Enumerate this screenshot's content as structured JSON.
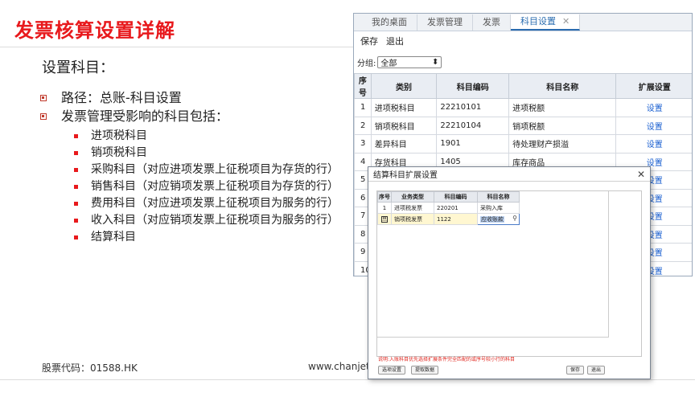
{
  "slide": {
    "title": "发票核算设置详解",
    "subtitle": "设置科目：",
    "bullets": [
      "路径：总账-科目设置",
      "发票管理受影响的科目包括："
    ],
    "sub_bullets": [
      "进项税科目",
      "销项税科目",
      "采购科目（对应进项发票上征税项目为存货的行）",
      "销售科目（对应销项发票上征税项目为存货的行）",
      "费用科目（对应进项发票上征税项目为服务的行）",
      "收入科目（对应销项发票上征税项目为服务的行）",
      "结算科目"
    ],
    "footer_code": "股票代码：01588.HK",
    "footer_url": "www.chanjet"
  },
  "app": {
    "tabs": [
      "我的桌面",
      "发票管理",
      "发票",
      "科目设置"
    ],
    "close_glyph": "✕",
    "toolbar": {
      "save": "保存",
      "exit": "退出"
    },
    "filter": {
      "label": "分组:",
      "value": "全部",
      "arrow": "⬍"
    },
    "grid": {
      "headers": [
        "序号",
        "类别",
        "科目编码",
        "科目名称",
        "扩展设置"
      ],
      "rows": [
        [
          "1",
          "进项税科目",
          "22210101",
          "进项税额",
          "设置"
        ],
        [
          "2",
          "销项税科目",
          "22210104",
          "销项税额",
          "设置"
        ],
        [
          "3",
          "差异科目",
          "1901",
          "待处理财产损溢",
          "设置"
        ],
        [
          "4",
          "存货科目",
          "1405",
          "库存商品",
          "设置"
        ],
        [
          "5",
          "",
          "",
          "",
          "设置"
        ],
        [
          "6",
          "",
          "",
          "",
          "设置"
        ],
        [
          "7",
          "",
          "",
          "",
          "设置"
        ],
        [
          "8",
          "",
          "",
          "",
          "设置"
        ],
        [
          "9",
          "",
          "",
          "",
          "设置"
        ],
        [
          "10",
          "",
          "",
          "",
          "设置"
        ]
      ]
    }
  },
  "dialog": {
    "title": "结算科目扩展设置",
    "close_glyph": "✕",
    "headers": [
      "序号",
      "业务类型",
      "科目编码",
      "科目名称"
    ],
    "rows": [
      [
        "1",
        "进项税发票",
        "220201",
        "采购入库"
      ],
      [
        "",
        "销项税发票",
        "1122",
        "应收账款"
      ]
    ],
    "row_icon": "亘",
    "note": "说明:入账科目优先选择扩展条件完全匹配的或序号较小行的科目",
    "buttons": {
      "options": "选项设置",
      "fetch": "提取数据",
      "save": "保存",
      "exit": "退出"
    }
  }
}
